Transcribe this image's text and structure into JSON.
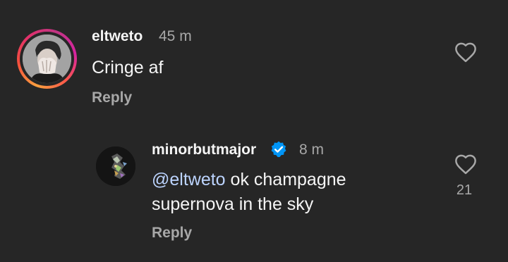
{
  "comments": [
    {
      "username": "eltweto",
      "time": "45 m",
      "text": "Cringe af",
      "reply_label": "Reply",
      "avatar": "profile-photo"
    }
  ],
  "replies": [
    {
      "username": "minorbutmajor",
      "verified": true,
      "time": "8 m",
      "mention": "@eltweto",
      "text_rest": " ok champagne",
      "text_line2": "supernova in the sky",
      "reply_label": "Reply",
      "likes": "21",
      "avatar": "profile-photo"
    }
  ],
  "icons": {
    "like": "heart-outline-icon",
    "verified": "verified-badge-icon"
  },
  "colors": {
    "background": "#262626",
    "secondary_text": "#a8a8a8",
    "mention": "#bcd4ff",
    "verified_blue": "#0095f6"
  }
}
